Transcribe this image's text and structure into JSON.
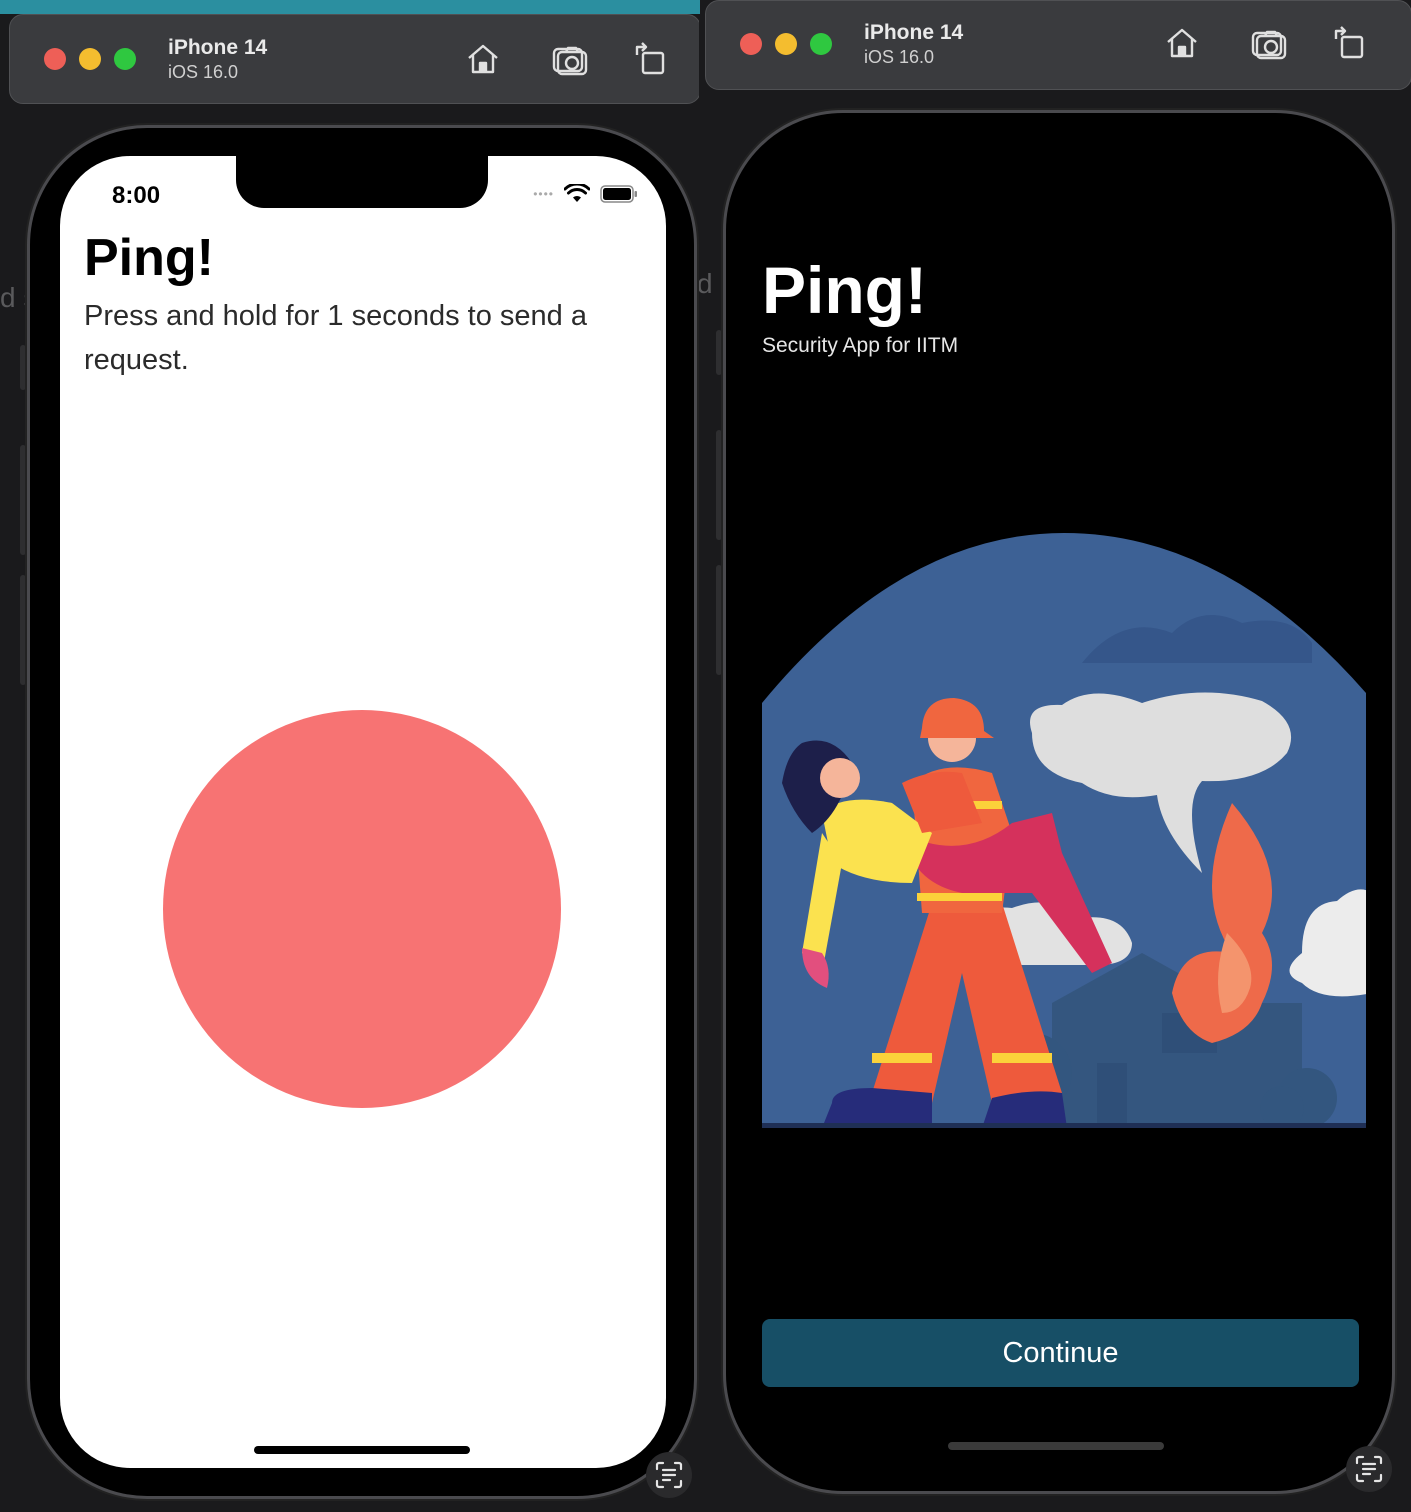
{
  "left_simulator": {
    "device_name": "iPhone 14",
    "os_version": "iOS 16.0",
    "status_time": "8:00",
    "app_title": "Ping!",
    "instruction": "Press and hold for 1 seconds to send a request."
  },
  "right_simulator": {
    "device_name": "iPhone 14",
    "os_version": "iOS 16.0",
    "app_title": "Ping!",
    "subtitle": "Security App for IITM",
    "continue_label": "Continue"
  },
  "background_fragment": "d s",
  "colors": {
    "ping_circle": "#f77373",
    "continue_button": "#174f66",
    "illustration_sky": "#3d6195",
    "traffic_red": "#ee5f57",
    "traffic_yellow": "#f4bd2f",
    "traffic_green": "#2fc840"
  },
  "toolbar_icons": [
    "home-icon",
    "screenshot-camera-icon",
    "rotate-icon"
  ]
}
